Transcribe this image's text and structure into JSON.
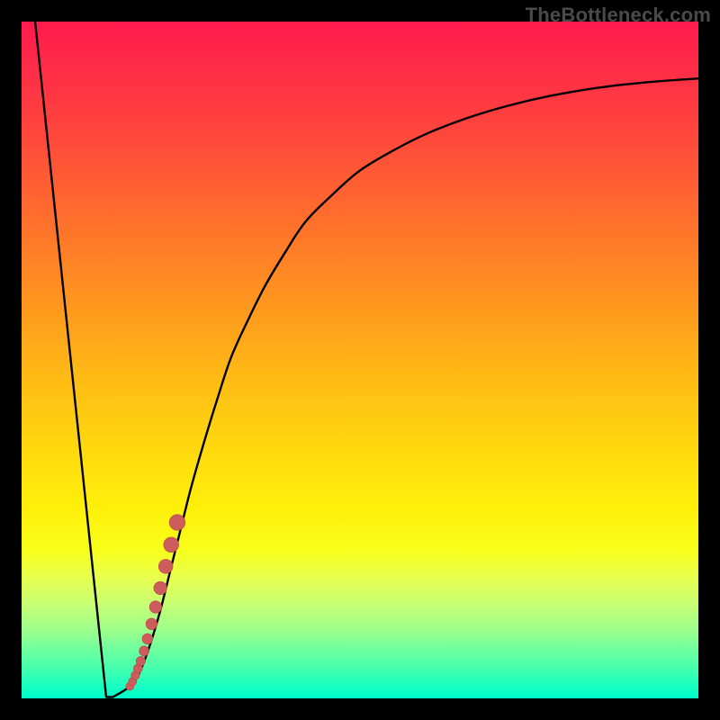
{
  "watermark": "TheBottleneck.com",
  "colors": {
    "curve": "#000000",
    "marker_fill": "#cd5c5c",
    "marker_stroke": "#b84a4a",
    "frame": "#000000"
  },
  "chart_data": {
    "type": "line",
    "title": "",
    "xlabel": "",
    "ylabel": "",
    "xlim": [
      0,
      100
    ],
    "ylim": [
      0,
      100
    ],
    "grid": false,
    "legend": false,
    "series": [
      {
        "name": "bottleneck-curve",
        "x": [
          2,
          12.5,
          13.5,
          16,
          17.5,
          19,
          20.5,
          22,
          23.5,
          25,
          27,
          29,
          31,
          33.5,
          36,
          39,
          42,
          46,
          50,
          55,
          60,
          66,
          72,
          78,
          85,
          92,
          100
        ],
        "y": [
          100,
          0.2,
          0.2,
          1.8,
          4,
          8,
          13,
          19,
          25,
          31,
          38,
          44.5,
          50.5,
          56,
          61,
          66,
          70.5,
          74.5,
          78,
          81,
          83.5,
          85.8,
          87.6,
          89,
          90.2,
          91,
          91.6
        ]
      }
    ],
    "markers": {
      "name": "highlight-segment",
      "x": [
        16.0,
        16.4,
        16.8,
        17.2,
        17.6,
        18.1,
        18.6,
        19.2,
        19.8,
        20.5,
        21.3,
        22.1,
        23.0
      ],
      "y": [
        1.8,
        2.5,
        3.4,
        4.4,
        5.5,
        7.0,
        8.8,
        11.0,
        13.5,
        16.3,
        19.5,
        22.7,
        26.0
      ],
      "sizes": [
        4.5,
        4.6,
        4.8,
        5.0,
        5.2,
        5.5,
        5.9,
        6.3,
        6.8,
        7.3,
        7.9,
        8.4,
        8.8
      ]
    }
  }
}
